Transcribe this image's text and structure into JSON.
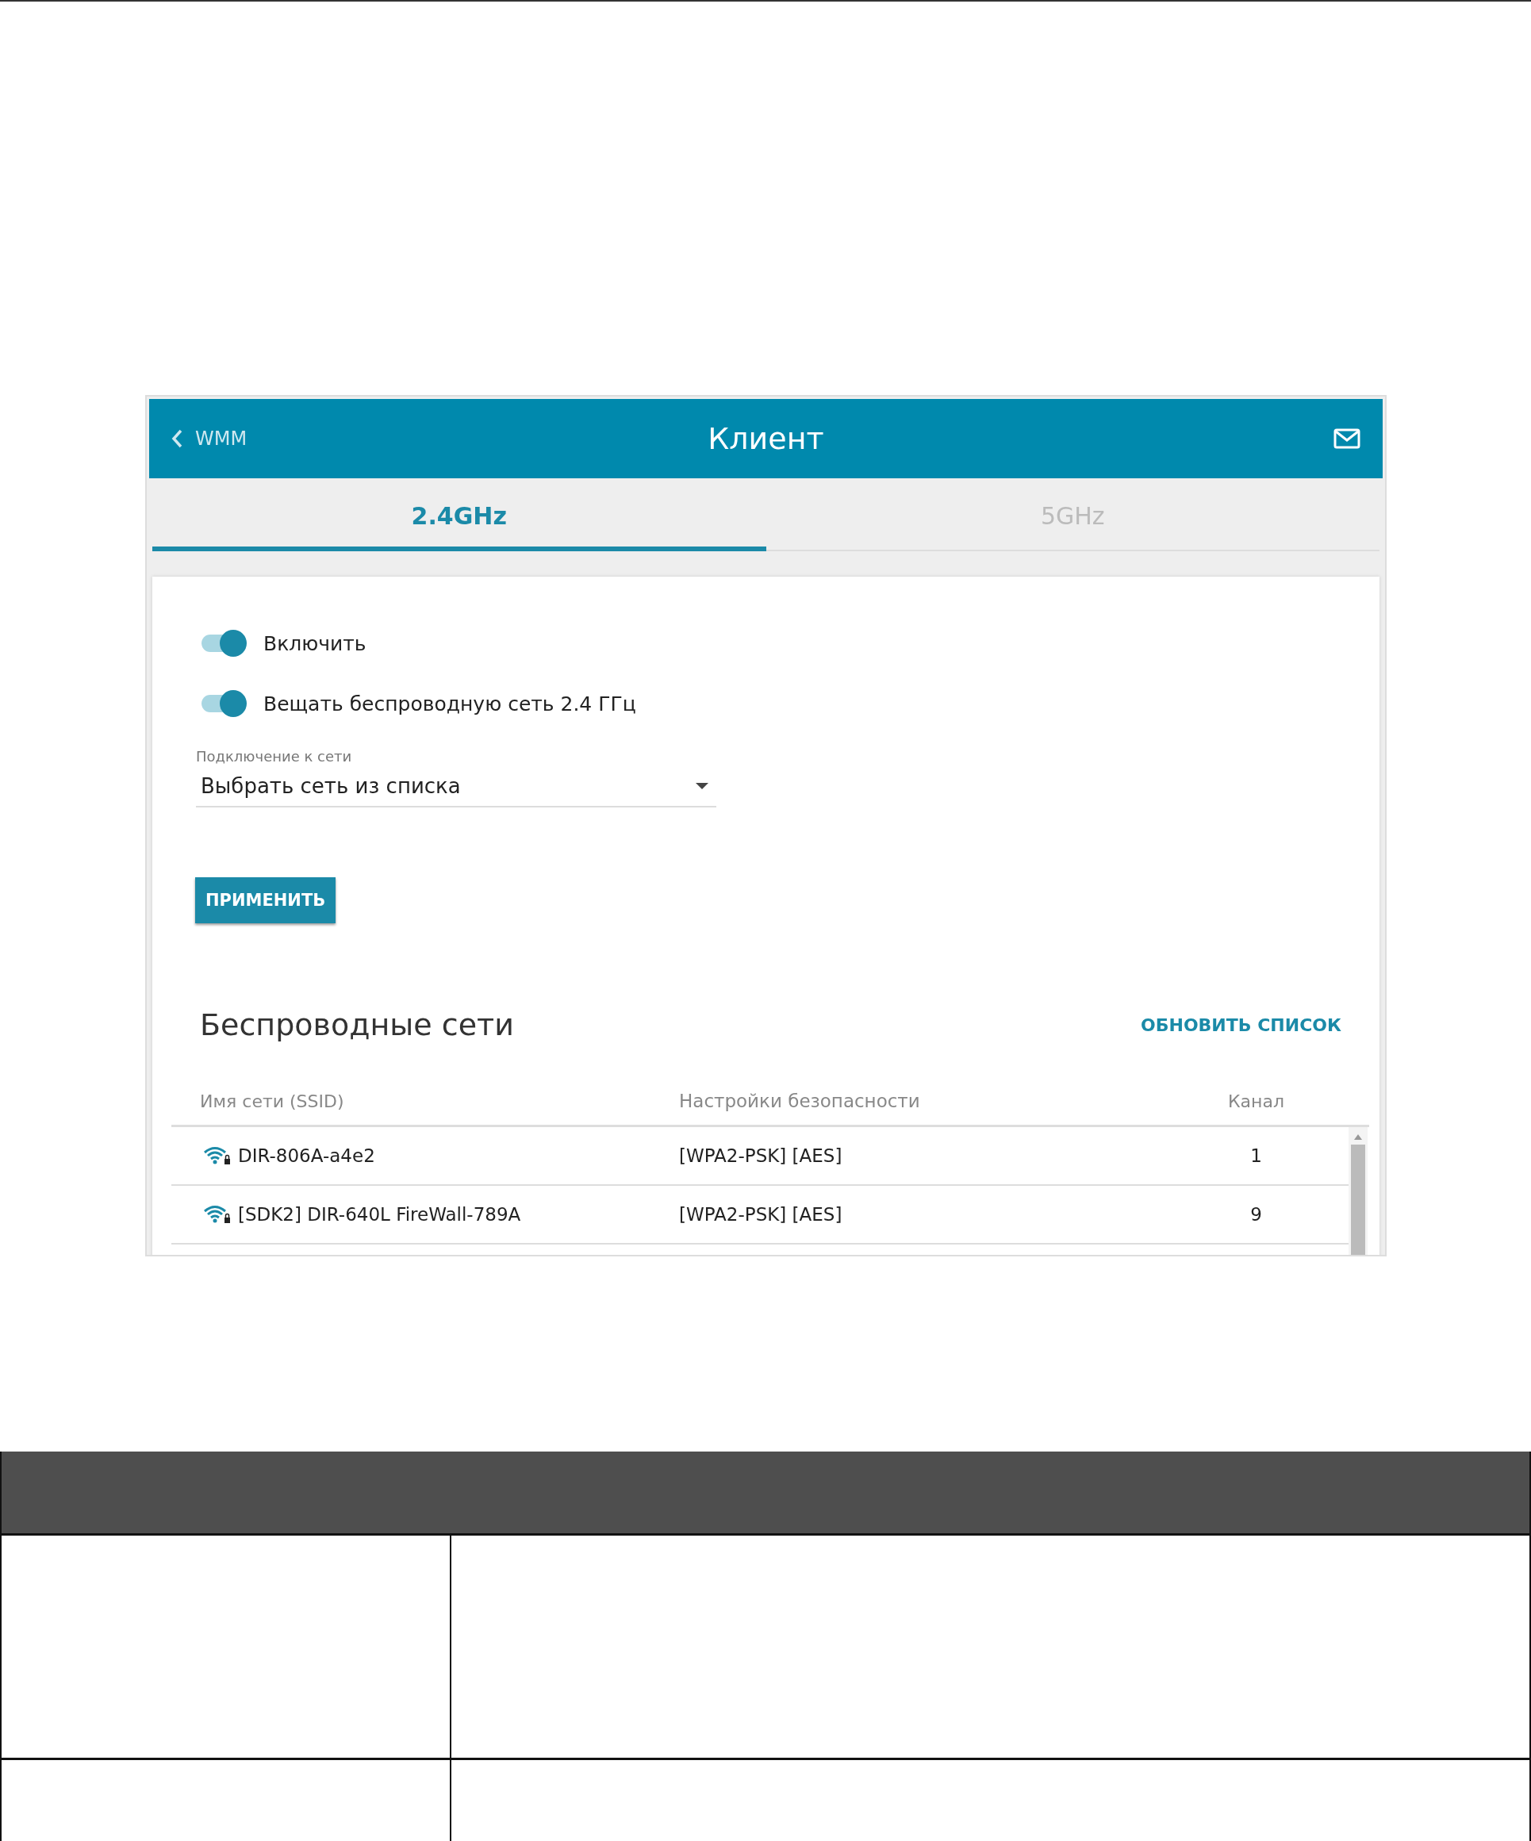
{
  "screen": {
    "header": {
      "back_label": "WMM",
      "title": "Клиент"
    },
    "tabs": [
      {
        "label": "2.4GHz",
        "selected": true
      },
      {
        "label": "5GHz",
        "selected": false
      }
    ],
    "toggles": [
      {
        "label": "Включить",
        "on": true
      },
      {
        "label": "Вещать беспроводную сеть 2.4 ГГц",
        "on": true
      }
    ],
    "connection": {
      "label": "Подключение к сети",
      "value": "Выбрать сеть из списка"
    },
    "apply_button": "ПРИМЕНИТЬ",
    "networks": {
      "title": "Беспроводные сети",
      "refresh_button": "ОБНОВИТЬ СПИСОК",
      "columns": [
        "Имя сети (SSID)",
        "Настройки безопасности",
        "Канал"
      ],
      "rows": [
        {
          "ssid": "DIR-806A-a4e2",
          "security": "[WPA2-PSK] [AES]",
          "channel": "1"
        },
        {
          "ssid": "[SDK2] DIR-640L FireWall-789A",
          "security": "[WPA2-PSK] [AES]",
          "channel": "9"
        }
      ]
    }
  }
}
